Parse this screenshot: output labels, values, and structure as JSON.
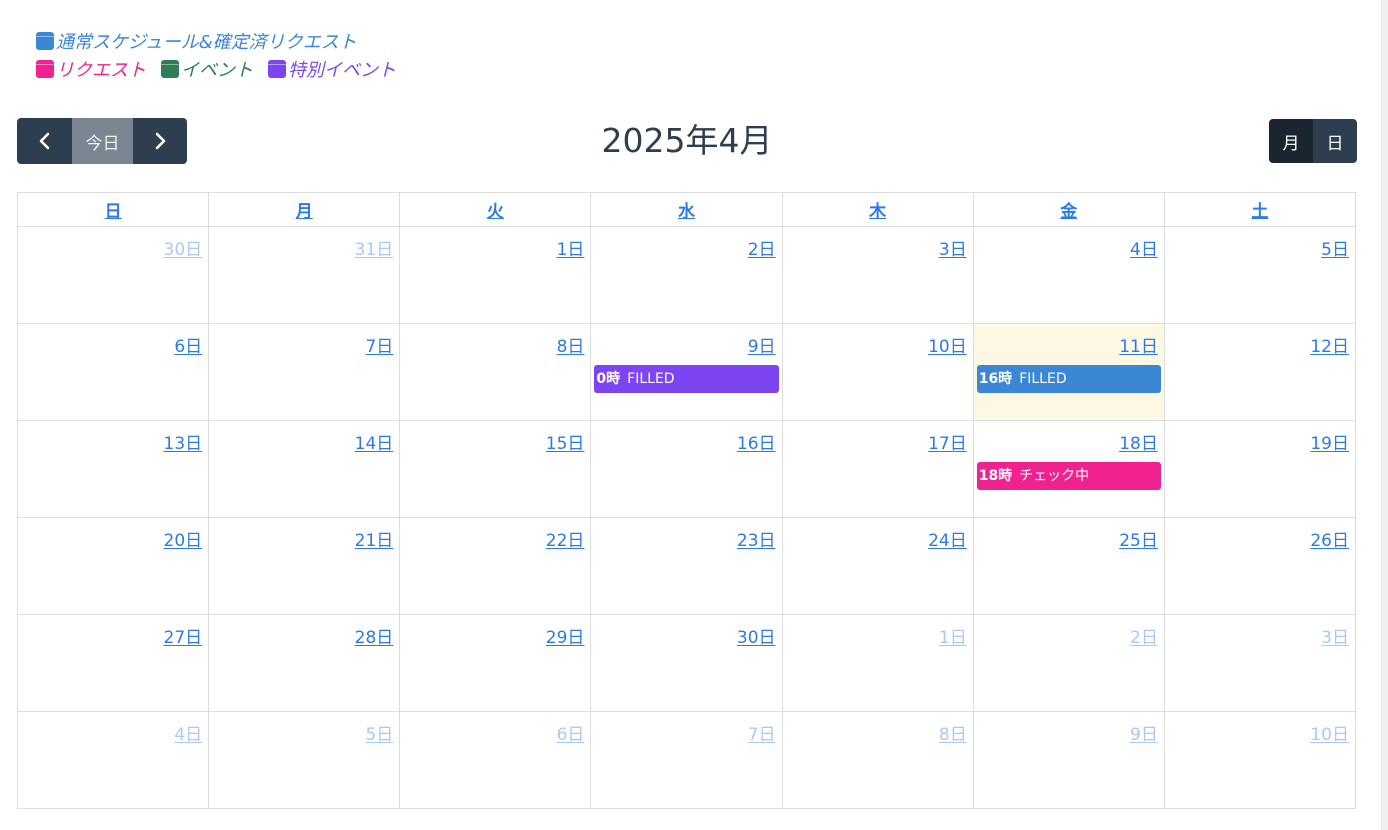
{
  "legend": {
    "items": [
      {
        "label": "通常スケジュール&確定済リクエスト",
        "color": "#3b87d6",
        "row": 0
      },
      {
        "label": "リクエスト",
        "color": "#f0228f",
        "row": 1
      },
      {
        "label": "イベント",
        "color": "#2e7d55",
        "row": 1
      },
      {
        "label": "特別イベント",
        "color": "#7d45f2",
        "row": 1
      }
    ]
  },
  "toolbar": {
    "prev_icon": "chevron-left-icon",
    "today_label": "今日",
    "next_icon": "chevron-right-icon",
    "title": "2025年4月",
    "views": [
      {
        "label": "月",
        "active": true
      },
      {
        "label": "日",
        "active": false
      }
    ]
  },
  "calendar": {
    "weekdays": [
      "日",
      "月",
      "火",
      "水",
      "木",
      "金",
      "土"
    ],
    "weeks": [
      [
        {
          "label": "30日",
          "other": true
        },
        {
          "label": "31日",
          "other": true
        },
        {
          "label": "1日"
        },
        {
          "label": "2日"
        },
        {
          "label": "3日"
        },
        {
          "label": "4日"
        },
        {
          "label": "5日"
        }
      ],
      [
        {
          "label": "6日"
        },
        {
          "label": "7日"
        },
        {
          "label": "8日"
        },
        {
          "label": "9日",
          "event": {
            "time": "0時",
            "title": "FILLED",
            "color": "#7d45f2"
          }
        },
        {
          "label": "10日"
        },
        {
          "label": "11日",
          "today": true,
          "event": {
            "time": "16時",
            "title": "FILLED",
            "color": "#3b87d6"
          }
        },
        {
          "label": "12日"
        }
      ],
      [
        {
          "label": "13日"
        },
        {
          "label": "14日"
        },
        {
          "label": "15日"
        },
        {
          "label": "16日"
        },
        {
          "label": "17日"
        },
        {
          "label": "18日",
          "event": {
            "time": "18時",
            "title": "チェック中",
            "color": "#f0228f"
          }
        },
        {
          "label": "19日"
        }
      ],
      [
        {
          "label": "20日"
        },
        {
          "label": "21日"
        },
        {
          "label": "22日"
        },
        {
          "label": "23日"
        },
        {
          "label": "24日"
        },
        {
          "label": "25日"
        },
        {
          "label": "26日"
        }
      ],
      [
        {
          "label": "27日"
        },
        {
          "label": "28日"
        },
        {
          "label": "29日"
        },
        {
          "label": "30日"
        },
        {
          "label": "1日",
          "other": true
        },
        {
          "label": "2日",
          "other": true
        },
        {
          "label": "3日",
          "other": true
        }
      ],
      [
        {
          "label": "4日",
          "other": true
        },
        {
          "label": "5日",
          "other": true
        },
        {
          "label": "6日",
          "other": true
        },
        {
          "label": "7日",
          "other": true
        },
        {
          "label": "8日",
          "other": true
        },
        {
          "label": "9日",
          "other": true
        },
        {
          "label": "10日",
          "other": true
        }
      ]
    ]
  }
}
